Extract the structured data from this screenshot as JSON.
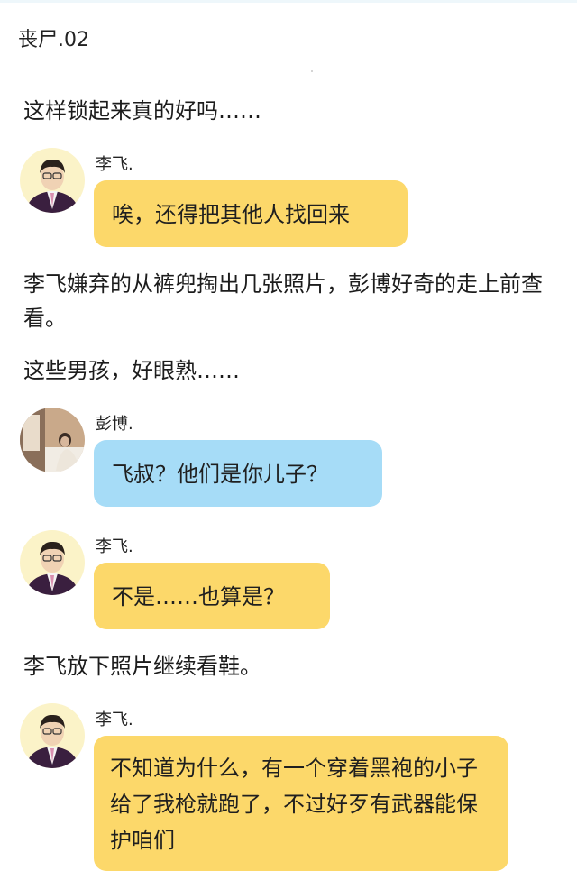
{
  "chapter_title": "丧尸.02",
  "colors": {
    "yellow_bubble": "#fcd86a",
    "blue_bubble": "#a6dcf7"
  },
  "messages": {
    "n1": "这样锁起来真的好吗……",
    "m1": {
      "speaker": "李飞.",
      "text": "唉，还得把其他人找回来",
      "avatar": "man-in-suit-avatar"
    },
    "n2": "李飞嫌弃的从裤兜掏出几张照片，彭博好奇的走上前查看。",
    "n3": "这些男孩，好眼熟……",
    "m2": {
      "speaker": "彭博.",
      "text": "飞叔？他们是你儿子？",
      "avatar": "person-in-room-avatar"
    },
    "m3": {
      "speaker": "李飞.",
      "text": "不是……也算是？",
      "avatar": "man-in-suit-avatar"
    },
    "n4": "李飞放下照片继续看鞋。",
    "m4": {
      "speaker": "李飞.",
      "text": "不知道为什么，有一个穿着黑袍的小子给了我枪就跑了，不过好歹有武器能保护咱们",
      "avatar": "man-in-suit-avatar"
    }
  }
}
